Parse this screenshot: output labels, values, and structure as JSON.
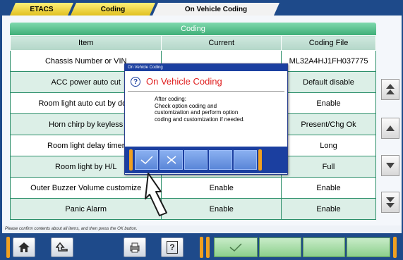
{
  "tabs": [
    {
      "label": "ETACS"
    },
    {
      "label": "Coding"
    },
    {
      "label": "On Vehicle Coding"
    }
  ],
  "table": {
    "title": "Coding",
    "columns": [
      "Item",
      "Current",
      "Coding File"
    ],
    "rows": [
      {
        "item": "Chassis Number or VIN",
        "current": "",
        "coding_file": "ML32A4HJ1FH037775"
      },
      {
        "item": "ACC power auto cut",
        "current": "",
        "coding_file": "Default disable"
      },
      {
        "item": "Room light auto cut by door",
        "current": "",
        "coding_file": "Enable"
      },
      {
        "item": "Horn chirp by keyless",
        "current": "",
        "coding_file": "Present/Chg Ok"
      },
      {
        "item": "Room light delay timer",
        "current": "",
        "coding_file": "Long"
      },
      {
        "item": "Room light by H/L",
        "current": "",
        "coding_file": "Full"
      },
      {
        "item": "Outer Buzzer Volume customize",
        "current": "Enable",
        "coding_file": "Enable"
      },
      {
        "item": "Panic Alarm",
        "current": "Enable",
        "coding_file": "Enable"
      }
    ]
  },
  "status_text": "Please confirm contents about all items, and then press the OK button.",
  "dialog": {
    "title": "On Vehicle Coding",
    "heading": "On Vehicle Coding",
    "help_glyph": "?",
    "message_lines": [
      "After coding:",
      "Check option coding and",
      "customization and perform option",
      "coding and customization if needed."
    ]
  },
  "toolbar": {
    "help_glyph": "?"
  },
  "colors": {
    "frame_blue": "#1e4a8a",
    "grid_green": "#2c8f6a",
    "header_green": "#3fae77",
    "accent_orange": "#f0a020",
    "dialog_red": "#e02020"
  },
  "icons": [
    "home-icon",
    "up-arrow-icon",
    "printer-icon",
    "help-icon",
    "checkmark-icon",
    "cross-icon",
    "pointer-cursor-icon"
  ]
}
